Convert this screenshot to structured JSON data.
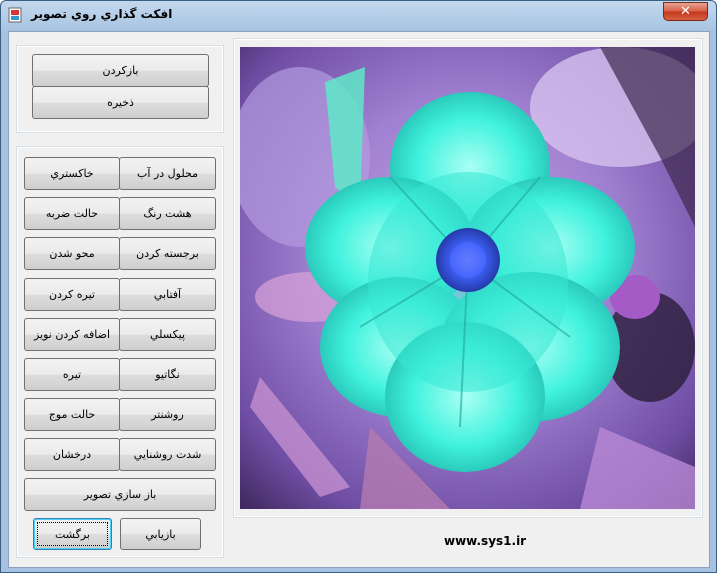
{
  "window": {
    "title": "افکت گذاري روي تصوير",
    "close_glyph": "✕"
  },
  "top_group": {
    "restore_label": "بازکردن",
    "save_label": "ذخيره"
  },
  "effects": {
    "rows": [
      {
        "right": "محلول در آب",
        "left": "خاکستري"
      },
      {
        "right": "هشت رنگ",
        "left": "حالت ضربه"
      },
      {
        "right": "برجسته کردن",
        "left": "محو شدن"
      },
      {
        "right": "آفتابي",
        "left": "تيره کردن"
      },
      {
        "right": "پيکسلي",
        "left": "اضافه کردن نويز"
      },
      {
        "right": "نگاتيو",
        "left": "تيره"
      },
      {
        "right": "روشنتر",
        "left": "حالت موج"
      },
      {
        "right": "شدت روشنايي",
        "left": "درخشان"
      }
    ],
    "reconstruct_label": "باز سازي تصوير",
    "recover_label": "بازيابي",
    "back_label": "برگشت"
  },
  "picture": {
    "icon": "inverted-flower-image"
  },
  "footer": {
    "site": "www.sys1.ir"
  }
}
